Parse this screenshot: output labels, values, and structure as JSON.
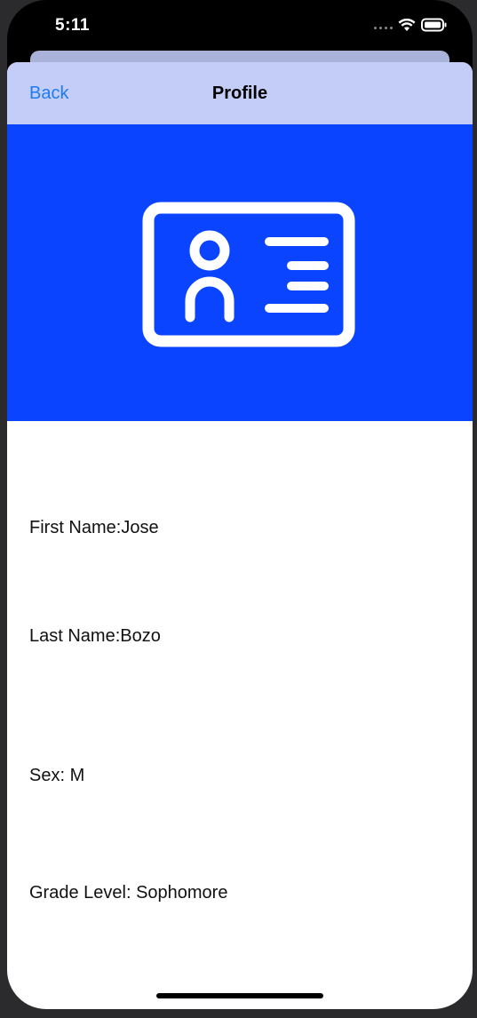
{
  "status_bar": {
    "time": "5:11",
    "icons": [
      "signal-dots-icon",
      "wifi-icon",
      "battery-icon"
    ]
  },
  "nav": {
    "back_label": "Back",
    "title": "Profile"
  },
  "hero": {
    "icon": "id-card-icon",
    "background_color": "#0b44ff"
  },
  "profile": {
    "first_name": "First Name:Jose",
    "last_name": "Last Name:Bozo",
    "sex": "Sex: M",
    "grade_level": "Grade Level: Sophomore"
  },
  "colors": {
    "nav_background": "#c3cdf7",
    "accent": "#1d7cf2"
  }
}
